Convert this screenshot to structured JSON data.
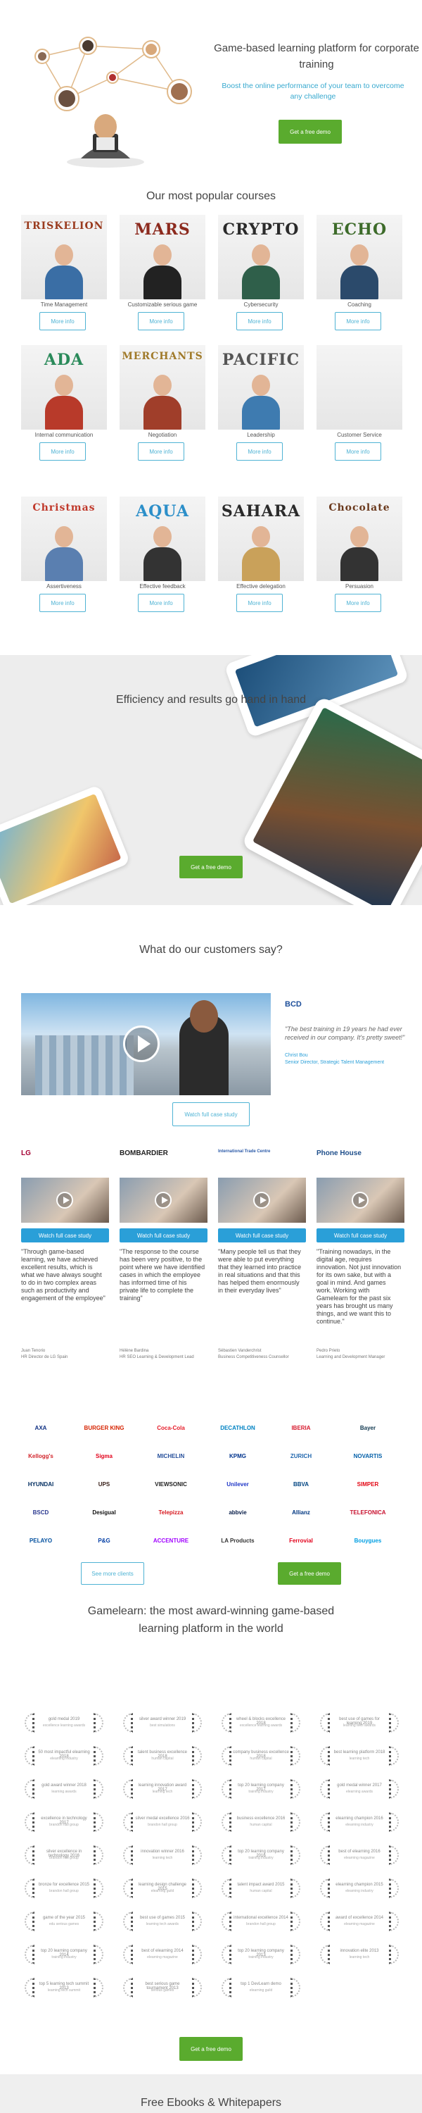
{
  "hero": {
    "title": "Game-based learning platform for corporate training",
    "subtitle": "Boost the online performance of your team to overcome any challenge",
    "cta": "Get a free demo"
  },
  "courses_section": {
    "title": "Our most popular courses",
    "more_label": "More info",
    "courses": [
      {
        "word": "TRISKELION",
        "name": "Time Management",
        "color": "#9a3b1e",
        "shirt": "#3a6ea5"
      },
      {
        "word": "MARS",
        "name": "Customizable serious game",
        "color": "#8c2a1e",
        "shirt": "#222222"
      },
      {
        "word": "CRYPTO",
        "name": "Cybersecurity",
        "color": "#2a2a2a",
        "shirt": "#2f5f4a"
      },
      {
        "word": "ECHO",
        "name": "Coaching",
        "color": "#3d6b2a",
        "shirt": "#2b4a6b"
      },
      {
        "word": "ADA",
        "name": "Internal communication",
        "color": "#2a8a5a",
        "shirt": "#b83a2a"
      },
      {
        "word": "MERCHANTS",
        "name": "Negotiation",
        "color": "#a07a2a",
        "shirt": "#a03e2a"
      },
      {
        "word": "PACIFIC",
        "name": "Leadership",
        "color": "#555555",
        "shirt": "#3e7bb0"
      },
      {
        "word": "",
        "name": "Customer Service",
        "color": "#999999",
        "shirt": "#f0f0f0"
      },
      {
        "word": "Christmas",
        "name": "Assertiveness",
        "color": "#c0392b",
        "shirt": "#5a7fb0"
      },
      {
        "word": "AQUA",
        "name": "Effective feedback",
        "color": "#2c8fc9",
        "shirt": "#333333"
      },
      {
        "word": "SAHARA",
        "name": "Effective delegation",
        "color": "#2a2a2a",
        "shirt": "#c9a15a"
      },
      {
        "word": "Chocolate",
        "name": "Persuasion",
        "color": "#6b3a1e",
        "shirt": "#333333"
      }
    ]
  },
  "efficiency": {
    "title": "Efficiency and results go hand in hand",
    "cta": "Get a free demo"
  },
  "testimonials": {
    "title": "What do our customers say?",
    "featured": {
      "logo": "BCD",
      "quote": "\"The best training in 19 years he had ever received in our company. It's pretty sweet!\"",
      "author": "Christ Bou",
      "role": "Senior Director, Strategic Talent Management",
      "cta": "Watch full case study"
    },
    "watch_label": "Watch full case study",
    "cards": [
      {
        "logo": "LG",
        "logo_color": "#a50034",
        "quote": "\"Through game-based learning, we have achieved excellent results, which is what we have always sought to do in two complex areas such as productivity and engagement of the employee\"",
        "author": "Juan Tenorio",
        "role": "HR Director de LG Spain"
      },
      {
        "logo": "BOMBARDIER",
        "logo_color": "#222222",
        "quote": "\"The response to the course has been very positive, to the point where we have identified cases in which the employee has informed time of his private life to complete the training\"",
        "author": "Hélène Bardina",
        "role": "HR SEO Learning & Development Lead"
      },
      {
        "logo": "International Trade Centre",
        "logo_color": "#2b5aa8",
        "quote": "\"Many people tell us that they were able to put everything that they learned into practice in real situations and that this has helped them enormously in their everyday lives\"",
        "author": "Sébastien Vanderchrist",
        "role": "Business Competitiveness Counsellor"
      },
      {
        "logo": "Phone House",
        "logo_color": "#1f4f8b",
        "quote": "\"Training nowadays, in the digital age, requires innovation. Not just innovation for its own sake, but with a goal in mind. And games work. Working with Gamelearn for the past six years has brought us many things, and we want this to continue.\"",
        "author": "Pedro Prieto",
        "role": "Learning and Development Manager"
      }
    ]
  },
  "clients": {
    "logos": [
      {
        "name": "AXA",
        "color": "#103184"
      },
      {
        "name": "BURGER KING",
        "color": "#d62300"
      },
      {
        "name": "Coca-Cola",
        "color": "#e61a27"
      },
      {
        "name": "DECATHLON",
        "color": "#0082c3"
      },
      {
        "name": "IBERIA",
        "color": "#d7192d"
      },
      {
        "name": "Bayer",
        "color": "#10384f"
      },
      {
        "name": "Kellogg's",
        "color": "#d2242b"
      },
      {
        "name": "Sigma",
        "color": "#e2001a"
      },
      {
        "name": "MICHELIN",
        "color": "#27509b"
      },
      {
        "name": "KPMG",
        "color": "#00338d"
      },
      {
        "name": "ZURICH",
        "color": "#2167ae"
      },
      {
        "name": "NOVARTIS",
        "color": "#0460a9"
      },
      {
        "name": "HYUNDAI",
        "color": "#002c5f"
      },
      {
        "name": "UPS",
        "color": "#351c15"
      },
      {
        "name": "VIEWSONIC",
        "color": "#222222"
      },
      {
        "name": "Unilever",
        "color": "#1f36c7"
      },
      {
        "name": "BBVA",
        "color": "#004481"
      },
      {
        "name": "SIMPER",
        "color": "#e30613"
      },
      {
        "name": "BSCD",
        "color": "#2b3990"
      },
      {
        "name": "Desigual",
        "color": "#111111"
      },
      {
        "name": "Telepizza",
        "color": "#d71920"
      },
      {
        "name": "abbvie",
        "color": "#071d49"
      },
      {
        "name": "Allianz",
        "color": "#003781"
      },
      {
        "name": "TELEFONICA",
        "color": "#c8102e"
      },
      {
        "name": "PELAYO",
        "color": "#004f9f"
      },
      {
        "name": "P&G",
        "color": "#003da5"
      },
      {
        "name": "ACCENTURE",
        "color": "#a100ff"
      },
      {
        "name": "LA Products",
        "color": "#333333"
      },
      {
        "name": "Ferrovial",
        "color": "#e3001b"
      },
      {
        "name": "Bouygues",
        "color": "#009fe3"
      }
    ],
    "see_more": "See more clients",
    "cta": "Get a free demo"
  },
  "awards": {
    "title": "Gamelearn: the most award-winning game-based learning platform in the world",
    "items": [
      {
        "t1": "gold medal 2019",
        "t2": "excellence learning awards"
      },
      {
        "t1": "silver award winner 2019",
        "t2": "best simulations"
      },
      {
        "t1": "wheel & blocks excellence 2018",
        "t2": "excellence learning awards"
      },
      {
        "t1": "best use of games for learning 2019",
        "t2": "learning tech awards"
      },
      {
        "t1": "50 most impactful elearning 2018",
        "t2": "elearning industry"
      },
      {
        "t1": "talent business excellence 2018",
        "t2": "human capital"
      },
      {
        "t1": "company business excellence 2018",
        "t2": "human capital"
      },
      {
        "t1": "best learning platform 2018",
        "t2": "learning tech"
      },
      {
        "t1": "gold award winner 2018",
        "t2": "learning awards"
      },
      {
        "t1": "learning innovation award 2017",
        "t2": "learning tech"
      },
      {
        "t1": "top 20 learning company 2017",
        "t2": "training industry"
      },
      {
        "t1": "gold medal winner 2017",
        "t2": "elearning awards"
      },
      {
        "t1": "excellence in technology 2017",
        "t2": "brandon hall group"
      },
      {
        "t1": "silver medal excellence 2016",
        "t2": "brandon hall group"
      },
      {
        "t1": "business excellence 2016",
        "t2": "human capital"
      },
      {
        "t1": "elearning champion 2016",
        "t2": "elearning industry"
      },
      {
        "t1": "silver excellence in technology 2016",
        "t2": "brandon hall group"
      },
      {
        "t1": "innovation winner 2016",
        "t2": "learning tech"
      },
      {
        "t1": "top 20 learning company 2016",
        "t2": "training industry"
      },
      {
        "t1": "best of elearning 2016",
        "t2": "elearning magazine"
      },
      {
        "t1": "bronze for excellence 2015",
        "t2": "brandon hall group"
      },
      {
        "t1": "learning design challenge 2015",
        "t2": "elearning guild"
      },
      {
        "t1": "talent impact award 2015",
        "t2": "human capital"
      },
      {
        "t1": "elearning champion 2015",
        "t2": "elearning industry"
      },
      {
        "t1": "game of the year 2015",
        "t2": "edu serious games"
      },
      {
        "t1": "best use of games 2015",
        "t2": "learning tech awards"
      },
      {
        "t1": "international excellence 2014",
        "t2": "brandon hall group"
      },
      {
        "t1": "award of excellence 2014",
        "t2": "elearning magazine"
      },
      {
        "t1": "top 20 learning company 2014",
        "t2": "training industry"
      },
      {
        "t1": "best of elearning 2014",
        "t2": "elearning magazine"
      },
      {
        "t1": "top 20 learning company 2013",
        "t2": "training industry"
      },
      {
        "t1": "innovation elite 2013",
        "t2": "learning tech"
      },
      {
        "t1": "top 5 learning tech summit 2013",
        "t2": "learning tech summit"
      },
      {
        "t1": "best serious game tournament 2013",
        "t2": "serious games"
      },
      {
        "t1": "top 1 DevLearn demo",
        "t2": "elearning guild"
      }
    ],
    "cta": "Get a free demo"
  },
  "ebooks": {
    "title": "Free Ebooks & Whitepapers"
  }
}
